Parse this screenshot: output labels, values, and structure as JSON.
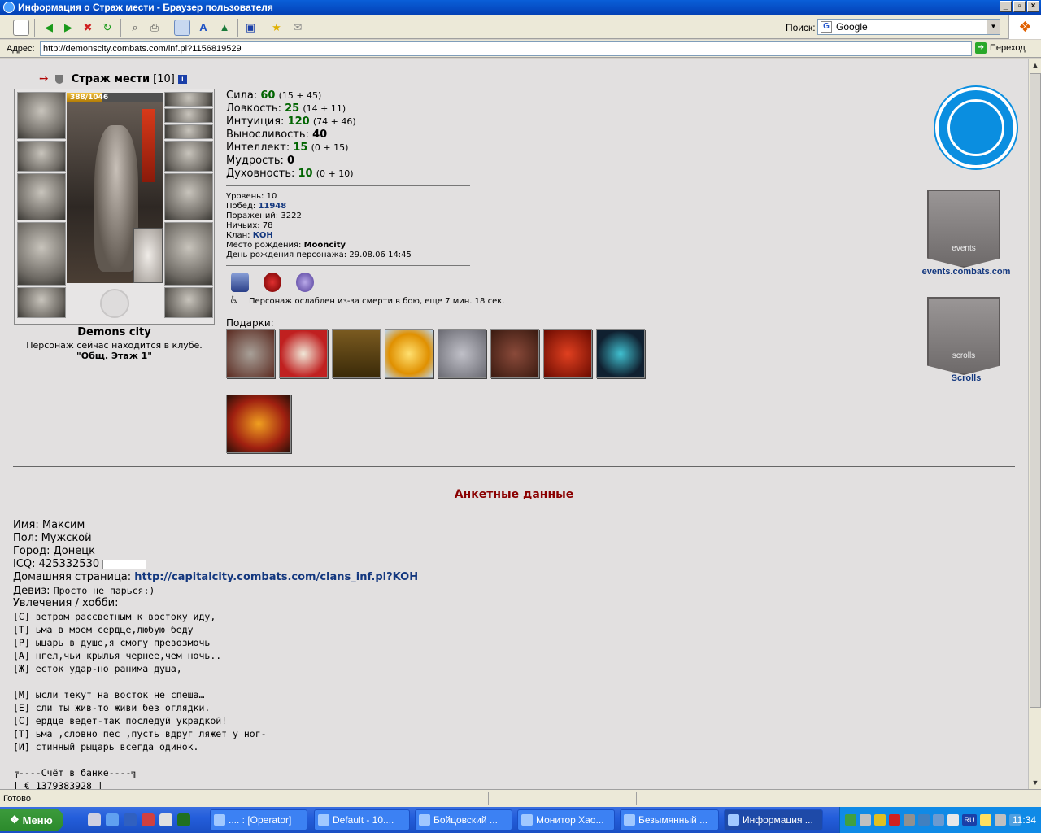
{
  "window": {
    "title": "Информация о Страж мести - Браузер пользователя"
  },
  "toolbar": {
    "search_label": "Поиск:",
    "search_value": "Google"
  },
  "address": {
    "label": "Адрес:",
    "url": "http://demonscity.combats.com/inf.pl?1156819529",
    "go_label": "Переход"
  },
  "character": {
    "name": "Страж мести",
    "level": "[10]",
    "hp_text": "388/1046",
    "hp_fraction": 0.371,
    "city": "Demons city",
    "location_line": "Персонаж сейчас находится в клубе.",
    "room": "\"Общ. Этаж 1\""
  },
  "stats": [
    {
      "label": "Сила:",
      "value": "60",
      "breakdown": "(15 + 45)"
    },
    {
      "label": "Ловкость:",
      "value": "25",
      "breakdown": "(14 + 11)"
    },
    {
      "label": "Интуиция:",
      "value": "120",
      "breakdown": "(74 + 46)"
    },
    {
      "label": "Выносливость:",
      "value": "40",
      "breakdown": ""
    },
    {
      "label": "Интеллект:",
      "value": "15",
      "breakdown": "(0 + 15)"
    },
    {
      "label": "Мудрость:",
      "value": "0",
      "breakdown": ""
    },
    {
      "label": "Духовность:",
      "value": "10",
      "breakdown": "(0 + 10)"
    }
  ],
  "info": {
    "level_label": "Уровень:",
    "level_value": "10",
    "wins_label": "Побед:",
    "wins_value": "11948",
    "losses_label": "Поражений:",
    "losses_value": "3222",
    "draws_label": "Ничьих:",
    "draws_value": "78",
    "clan_label": "Клан:",
    "clan_value": "КОН",
    "birthplace_label": "Место рождения:",
    "birthplace_value": "Mooncity",
    "birthday_label": "День рождения персонажа:",
    "birthday_value": "29.08.06 14:45"
  },
  "weakness_text": "Персонаж ослаблен из-за смерти в бою, еще 7 мин. 18 сек.",
  "gifts_label": "Подарки:",
  "side": {
    "events_link": "events.combats.com",
    "events_banner_text": "events",
    "scrolls_link": "Scrolls",
    "scrolls_banner_text": "scrolls"
  },
  "profile": {
    "title": "Анкетные данные",
    "name_label": "Имя:",
    "name_value": "Максим",
    "sex_label": "Пол:",
    "sex_value": "Мужской",
    "city_label": "Город:",
    "city_value": "Донецк",
    "icq_label": "ICQ:",
    "icq_value": "425332530",
    "homepage_label": "Домашняя страница:",
    "homepage_value": "http://capitalcity.combats.com/clans_inf.pl?KOH",
    "motto_label": "Девиз:",
    "motto_value": "Просто не парься:)",
    "hobby_label": "Увлечения / хобби:",
    "poem": [
      "[С] ветром рассветным к востоку иду,",
      "[Т] ьма в моем сердце,любую беду",
      "[Р] ыцарь в душе,я смогу превозмочь",
      "[А] нгел,чьи крылья чернее,чем ночь..",
      "[Ж] есток удар-но ранима душа,",
      "",
      "[М] ысли текут на восток не спеша…",
      "[Е] сли ты жив-то живи без оглядки.",
      "[С] ердце ведет-так последуй украдкой!",
      "[Т] ьма ,словно пес ,пусть вдруг ляжет у ног-",
      "[И] стинный рыцарь всегда одинок.",
      "",
      "╔----Счёт в банке----╗",
      "|  €  1379383928     |"
    ]
  },
  "status": {
    "text": "Готово"
  },
  "taskbar": {
    "start": "Меню",
    "tasks": [
      ".... : [Operator]",
      "Default - 10....",
      "Бойцовский ...",
      "Монитор Хао...",
      "Безымянный ...",
      "Информация ..."
    ],
    "tray_lang": "RU",
    "clock": "11:34"
  }
}
